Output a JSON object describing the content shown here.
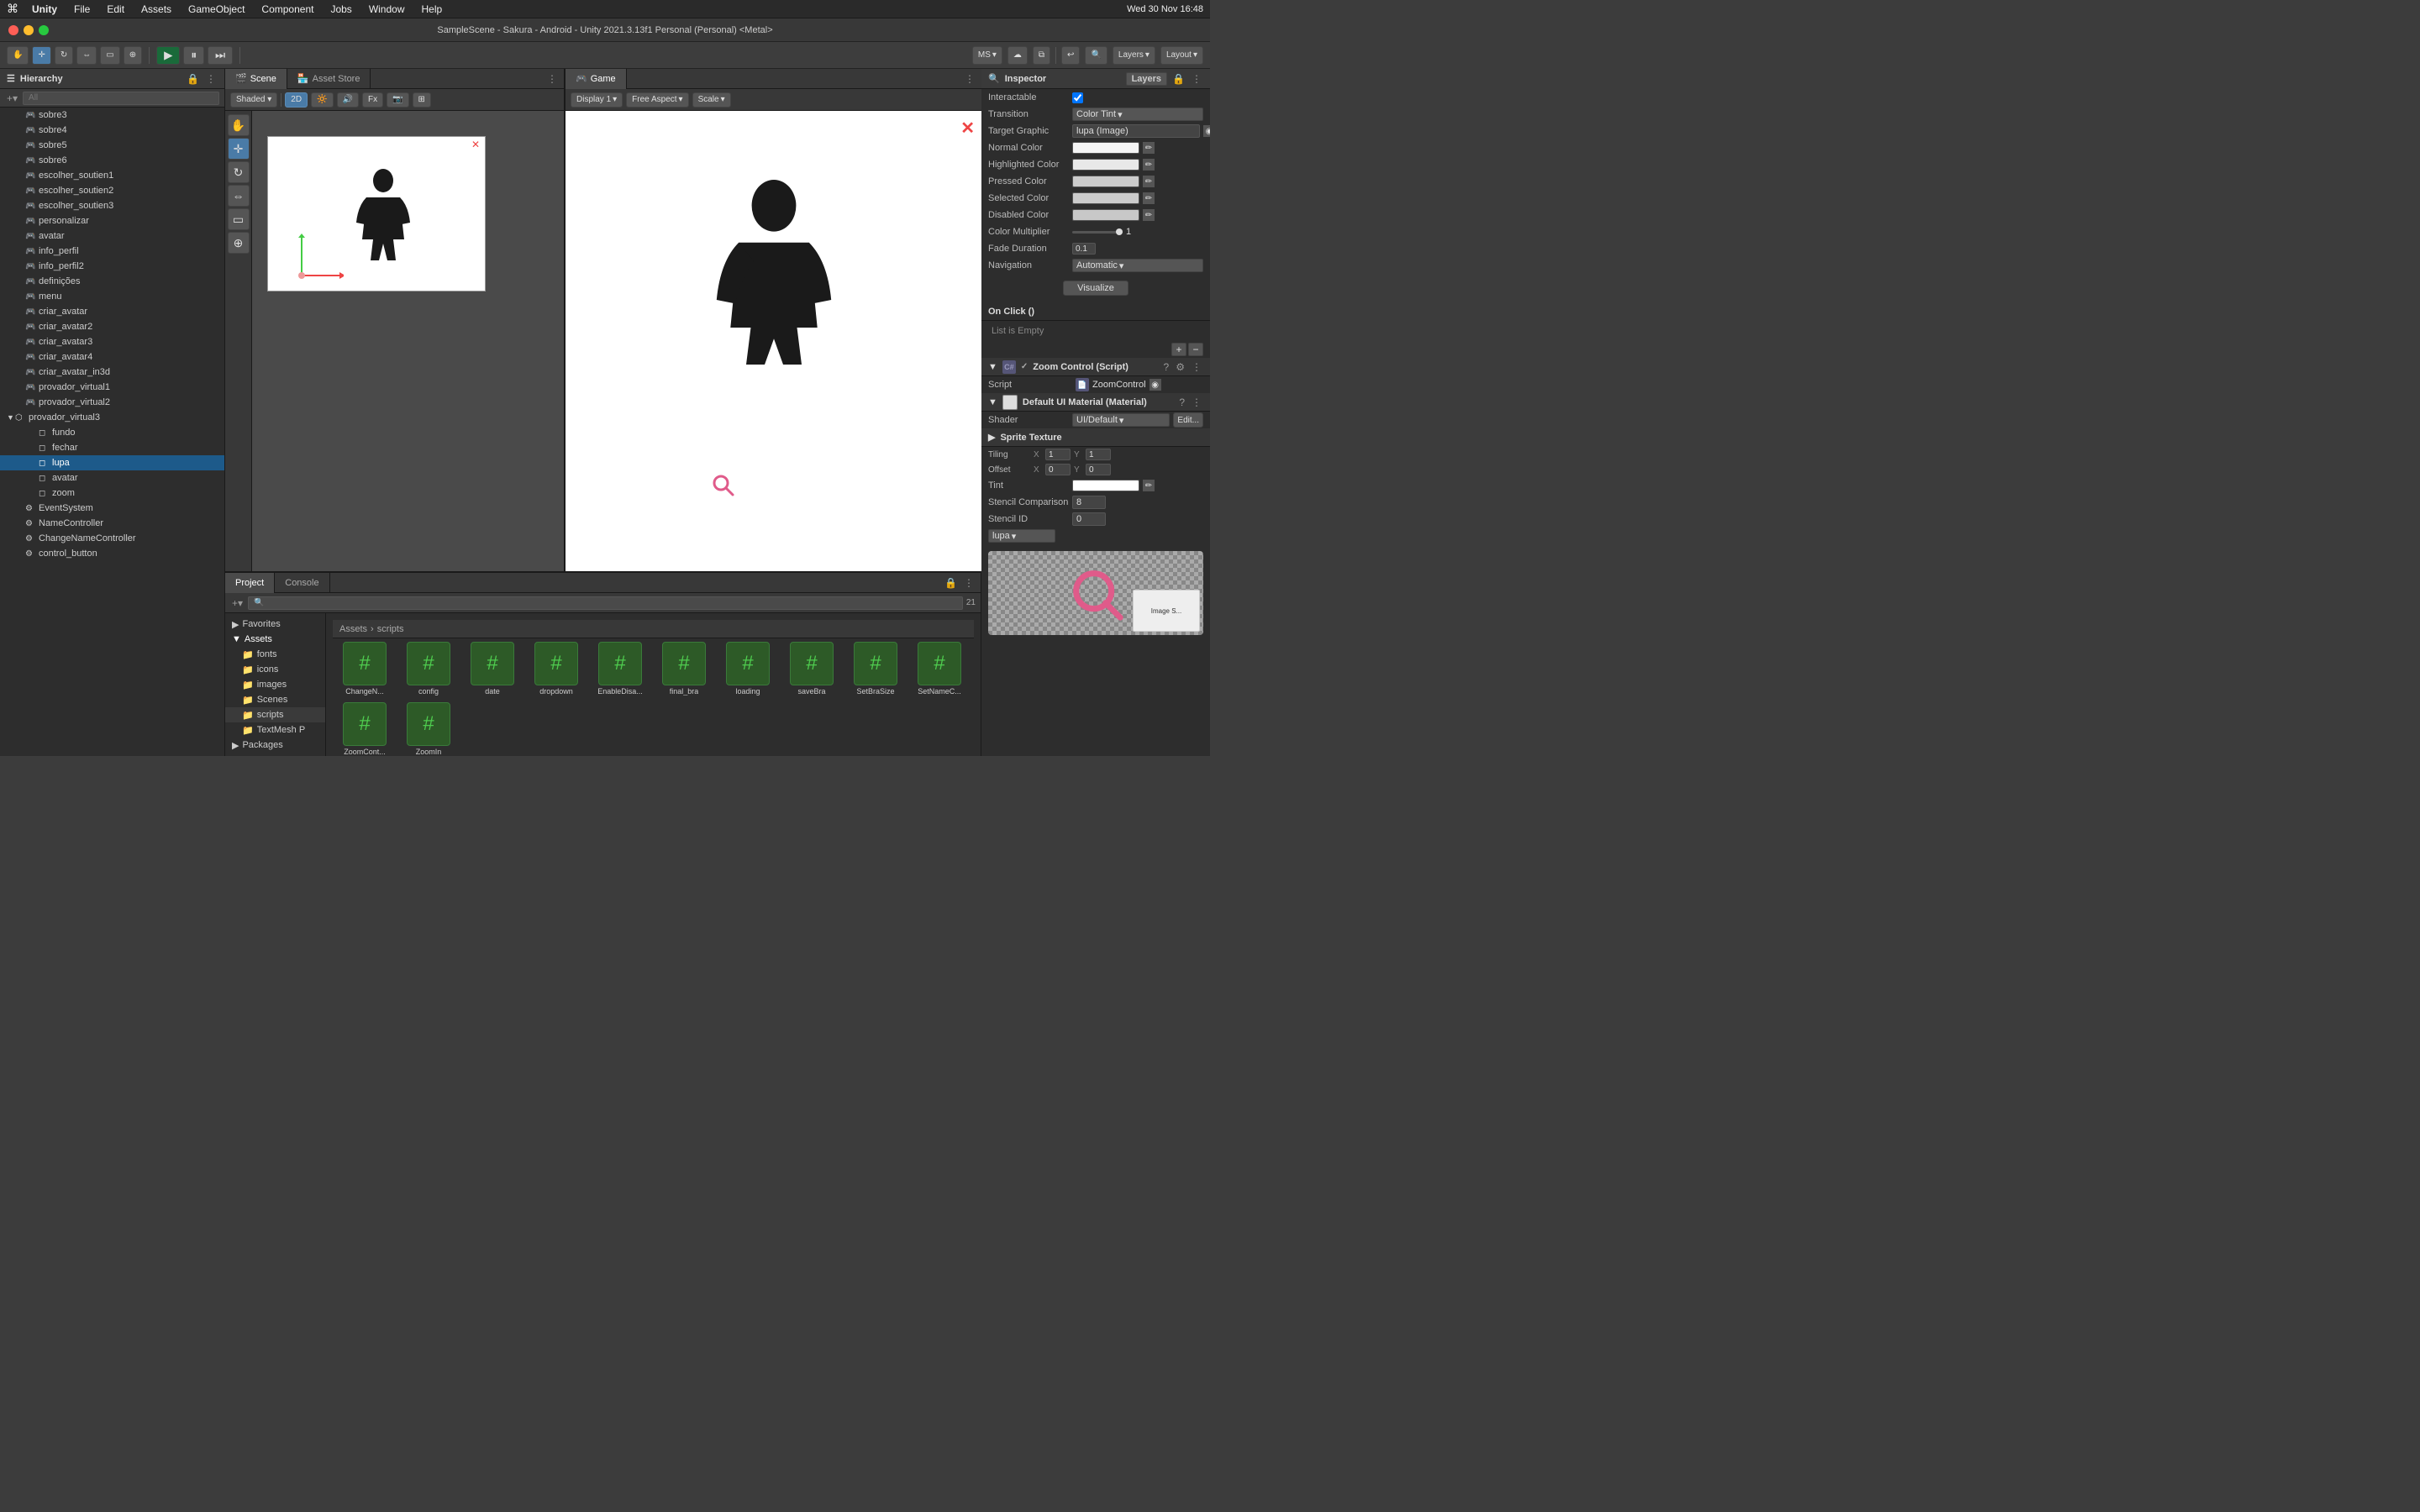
{
  "window": {
    "title": "SampleScene - Sakura - Android - Unity 2021.3.13f1 Personal (Personal) <Metal>",
    "app_name": "Unity"
  },
  "menubar": {
    "apple": "⌘",
    "items": [
      "Unity",
      "File",
      "Edit",
      "Assets",
      "GameObject",
      "Component",
      "Jobs",
      "Window",
      "Help"
    ],
    "right_time": "Wed 30 Nov  16:48"
  },
  "toolbar": {
    "play_label": "▶",
    "pause_label": "⏸",
    "step_label": "⏭",
    "account": "MS",
    "cloud_icon": "☁",
    "collab_icon": "⧉",
    "layers_label": "Layers",
    "layout_label": "Layout"
  },
  "hierarchy": {
    "title": "Hierarchy",
    "search_placeholder": "All",
    "items": [
      {
        "label": "sobre3",
        "depth": 1,
        "has_arrow": false
      },
      {
        "label": "sobre4",
        "depth": 1,
        "has_arrow": false
      },
      {
        "label": "sobre5",
        "depth": 1,
        "has_arrow": false
      },
      {
        "label": "sobre6",
        "depth": 1,
        "has_arrow": false
      },
      {
        "label": "escolher_soutien1",
        "depth": 1,
        "has_arrow": false
      },
      {
        "label": "escolher_soutien2",
        "depth": 1,
        "has_arrow": false
      },
      {
        "label": "escolher_soutien3",
        "depth": 1,
        "has_arrow": false
      },
      {
        "label": "personalizar",
        "depth": 1,
        "has_arrow": false
      },
      {
        "label": "avatar",
        "depth": 1,
        "has_arrow": false
      },
      {
        "label": "info_perfil",
        "depth": 1,
        "has_arrow": false
      },
      {
        "label": "info_perfil2",
        "depth": 1,
        "has_arrow": false
      },
      {
        "label": "definições",
        "depth": 1,
        "has_arrow": false
      },
      {
        "label": "menu",
        "depth": 1,
        "has_arrow": false
      },
      {
        "label": "criar_avatar",
        "depth": 1,
        "has_arrow": false
      },
      {
        "label": "criar_avatar2",
        "depth": 1,
        "has_arrow": false
      },
      {
        "label": "criar_avatar3",
        "depth": 1,
        "has_arrow": false
      },
      {
        "label": "criar_avatar4",
        "depth": 1,
        "has_arrow": false
      },
      {
        "label": "criar_avatar_in3d",
        "depth": 1,
        "has_arrow": false
      },
      {
        "label": "provador_virtual1",
        "depth": 1,
        "has_arrow": false
      },
      {
        "label": "provador_virtual2",
        "depth": 1,
        "has_arrow": false
      },
      {
        "label": "provador_virtual3",
        "depth": 1,
        "has_arrow": true,
        "expanded": true
      },
      {
        "label": "fundo",
        "depth": 2,
        "has_arrow": false
      },
      {
        "label": "fechar",
        "depth": 2,
        "has_arrow": false
      },
      {
        "label": "lupa",
        "depth": 2,
        "has_arrow": false,
        "selected": true
      },
      {
        "label": "avatar",
        "depth": 2,
        "has_arrow": false
      },
      {
        "label": "zoom",
        "depth": 2,
        "has_arrow": false
      },
      {
        "label": "EventSystem",
        "depth": 1,
        "has_arrow": false
      },
      {
        "label": "NameController",
        "depth": 1,
        "has_arrow": false
      },
      {
        "label": "ChangeNameController",
        "depth": 1,
        "has_arrow": false
      },
      {
        "label": "control_button",
        "depth": 1,
        "has_arrow": false
      }
    ]
  },
  "scene_view": {
    "title": "Scene",
    "toolbar": {
      "buttons": [
        "Shaded",
        "2D",
        "🔆",
        "Fx",
        "📷",
        "⚙"
      ],
      "active": "2D"
    }
  },
  "game_view": {
    "title": "Game",
    "display": "Display 1",
    "aspect": "Free Aspect",
    "scale": "Scale"
  },
  "inspector": {
    "title": "Inspector",
    "layers_label": "Layers",
    "interactable_label": "Interactable",
    "transition_label": "Transition",
    "transition_value": "Color Tint",
    "target_graphic_label": "Target Graphic",
    "target_graphic_value": "lupa (Image)",
    "normal_color_label": "Normal Color",
    "highlighted_color_label": "Highlighted Color",
    "pressed_color_label": "Pressed Color",
    "selected_color_label": "Selected Color",
    "disabled_color_label": "Disabled Color",
    "color_multiplier_label": "Color Multiplier",
    "color_multiplier_value": "1",
    "fade_duration_label": "Fade Duration",
    "fade_duration_value": "0.1",
    "navigation_label": "Navigation",
    "navigation_value": "Automatic",
    "visualize_label": "Visualize",
    "onclick_label": "On Click ()",
    "list_empty_label": "List is Empty",
    "zoom_control_label": "Zoom Control (Script)",
    "script_label": "Script",
    "script_value": "ZoomControl",
    "material_section": "Default UI Material (Material)",
    "shader_label": "Shader",
    "shader_value": "UI/Default",
    "edit_label": "Edit...",
    "sprite_texture_label": "Sprite Texture",
    "tiling_label": "Tiling",
    "tiling_x": "1",
    "tiling_y": "1",
    "offset_label": "Offset",
    "offset_x": "0",
    "offset_y": "0",
    "tint_label": "Tint",
    "stencil_comparison_label": "Stencil Comparison",
    "stencil_comparison_value": "8",
    "stencil_id_label": "Stencil ID",
    "stencil_id_value": "0",
    "lupa_dropdown": "lupa"
  },
  "project": {
    "title": "Project",
    "console_tab": "Console",
    "search_placeholder": "🔍",
    "favorites_label": "Favorites",
    "assets_label": "Assets",
    "folders": [
      "fonts",
      "icons",
      "images",
      "Scenes",
      "scripts",
      "TextMesh P"
    ],
    "packages_label": "Packages",
    "breadcrumb": [
      "Assets",
      "scripts"
    ],
    "files": [
      {
        "name": "ChangeN...",
        "icon": "#"
      },
      {
        "name": "config",
        "icon": "#"
      },
      {
        "name": "date",
        "icon": "#"
      },
      {
        "name": "dropdown",
        "icon": "#"
      },
      {
        "name": "EnableDisa...",
        "icon": "#"
      },
      {
        "name": "final_bra",
        "icon": "#"
      },
      {
        "name": "loading",
        "icon": "#"
      },
      {
        "name": "saveBra",
        "icon": "#"
      },
      {
        "name": "SetBraSize",
        "icon": "#"
      },
      {
        "name": "SetNameC...",
        "icon": "#"
      },
      {
        "name": "ZoomCont...",
        "icon": "#"
      },
      {
        "name": "ZoomIn",
        "icon": "#"
      }
    ],
    "file_count": "21"
  },
  "colors": {
    "normal_color": "#f5f5f5",
    "highlighted_color": "#e8e8e8",
    "pressed_color": "#c0c0c0",
    "selected_color": "#c0c0c0",
    "disabled_color": "#c8c8c8",
    "tint_color": "#ffffff",
    "accent": "#e05b8a"
  }
}
